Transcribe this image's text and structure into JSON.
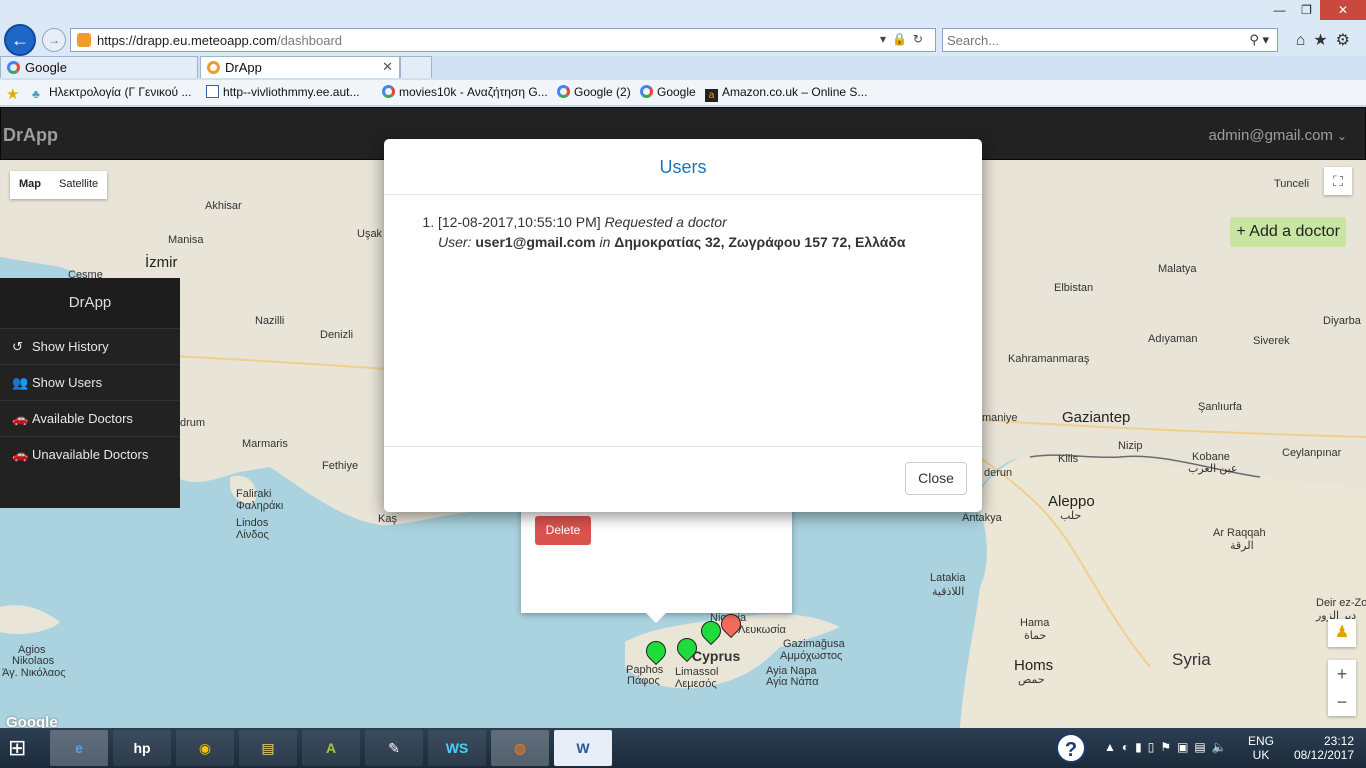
{
  "browser": {
    "url_host": "https://drapp.eu.meteoapp.com",
    "url_path": "/dashboard",
    "search_placeholder": "Search...",
    "tabs": [
      {
        "label": "Google"
      },
      {
        "label": "DrApp"
      }
    ],
    "favorites": [
      {
        "label": "Ηλεκτρολογία (Γ Γενικού ..."
      },
      {
        "label": "http--vivliothmmy.ee.aut..."
      },
      {
        "label": "movies10k - Αναζήτηση G..."
      },
      {
        "label": "Google (2)"
      },
      {
        "label": "Google"
      },
      {
        "label": "Amazon.co.uk – Online S..."
      }
    ]
  },
  "app": {
    "brand": "DrApp",
    "user_email": "admin@gmail.com",
    "map_type": {
      "map": "Map",
      "satellite": "Satellite"
    },
    "add_doctor": "+ Add a doctor",
    "google_logo": "Google"
  },
  "sidebar": {
    "title": "DrApp",
    "items": [
      {
        "label": "Show History",
        "icon": "history-icon"
      },
      {
        "label": "Show Users",
        "icon": "users-icon"
      },
      {
        "label": "Available Doctors",
        "icon": "car-icon"
      },
      {
        "label": "Unavailable Doctors",
        "icon": "car-icon"
      }
    ]
  },
  "info_window": {
    "delete_label": "Delete"
  },
  "map_labels": {
    "akhisar": "Akhisar",
    "manisa": "Manisa",
    "izmir": "İzmir",
    "cesme": "Çeşme",
    "nazilli": "Nazilli",
    "denizli": "Denizli",
    "usak": "Uşak",
    "marmaris": "Marmaris",
    "fethiye": "Fethiye",
    "faliraki": "Faliraki",
    "faliraki_gr": "Φαληράκι",
    "lindos": "Lindos",
    "lindos_gr": "Λίνδος",
    "kas": "Kaş",
    "agios": "Agios",
    "nikolaos": "Nikolaos",
    "nikolaos_gr": "Άγ. Νικόλαος",
    "bodrum": "drum",
    "tunceli": "Tunceli",
    "malatya": "Malatya",
    "elbistan": "Elbistan",
    "diyarbakir": "Diyarba",
    "adiyaman": "Adıyaman",
    "siverek": "Siverek",
    "kahramanmaras": "Kahramanmaraş",
    "gaziantep": "Gaziantep",
    "sanliurfa": "Şanlıurfa",
    "kilis": "Kilis",
    "nizip": "Nizip",
    "kobane": "Kobane",
    "kobane_ar": "عين العرب",
    "ceylanpinar": "Ceylanpınar",
    "aleppo": "Aleppo",
    "aleppo_ar": "حلب",
    "antakya": "Antakya",
    "latakia": "Latakia",
    "latakia_ar": "اللاذقية",
    "ar_raqqah": "Ar Raqqah",
    "ar_raqqah_ar": "الرقة",
    "hama": "Hama",
    "hama_ar": "حماة",
    "homs": "Homs",
    "homs_ar": "حمص",
    "syria": "Syria",
    "deir": "Deir ez-Zo",
    "deir_ar": "دير الزور",
    "cyprus": "Cyprus",
    "paphos": "Paphos",
    "paphos_gr": "Πάφος",
    "limassol": "Limassol",
    "limassol_gr": "Λεμεσός",
    "famagusta": "Gazimağusa",
    "famagusta_gr": "Αμμόχωστος",
    "ayia_napa": "Ayia Napa",
    "ayia_napa_gr": "Αγία Νάπα",
    "nicosia": "Nicosia",
    "nicosia_gr": "Λευκωσία",
    "maniye": "maniye",
    "derun": "derun",
    "iskenderun": "dırum"
  },
  "modal": {
    "title": "Users",
    "entries": [
      {
        "timestamp": "[12-08-2017,10:55:10 PM]",
        "action": "Requested a doctor",
        "user_label": "User:",
        "user_email": "user1@gmail.com",
        "in_label": "in",
        "address": "Δημοκρατίας 32, Ζωγράφου 157 72, Ελλάδα"
      }
    ],
    "close_label": "Close"
  },
  "taskbar": {
    "apps": [
      {
        "name": "internet-explorer",
        "label": "e"
      },
      {
        "name": "hp",
        "label": "hp"
      },
      {
        "name": "chrome",
        "label": "◉"
      },
      {
        "name": "file-explorer",
        "label": "▤"
      },
      {
        "name": "android-studio",
        "label": "A"
      },
      {
        "name": "paint",
        "label": "✎"
      },
      {
        "name": "webstorm",
        "label": "WS"
      },
      {
        "name": "firefox",
        "label": "◍"
      },
      {
        "name": "word",
        "label": "W"
      }
    ],
    "lang_top": "ENG",
    "lang_bottom": "UK",
    "time": "23:12",
    "date": "08/12/2017"
  }
}
